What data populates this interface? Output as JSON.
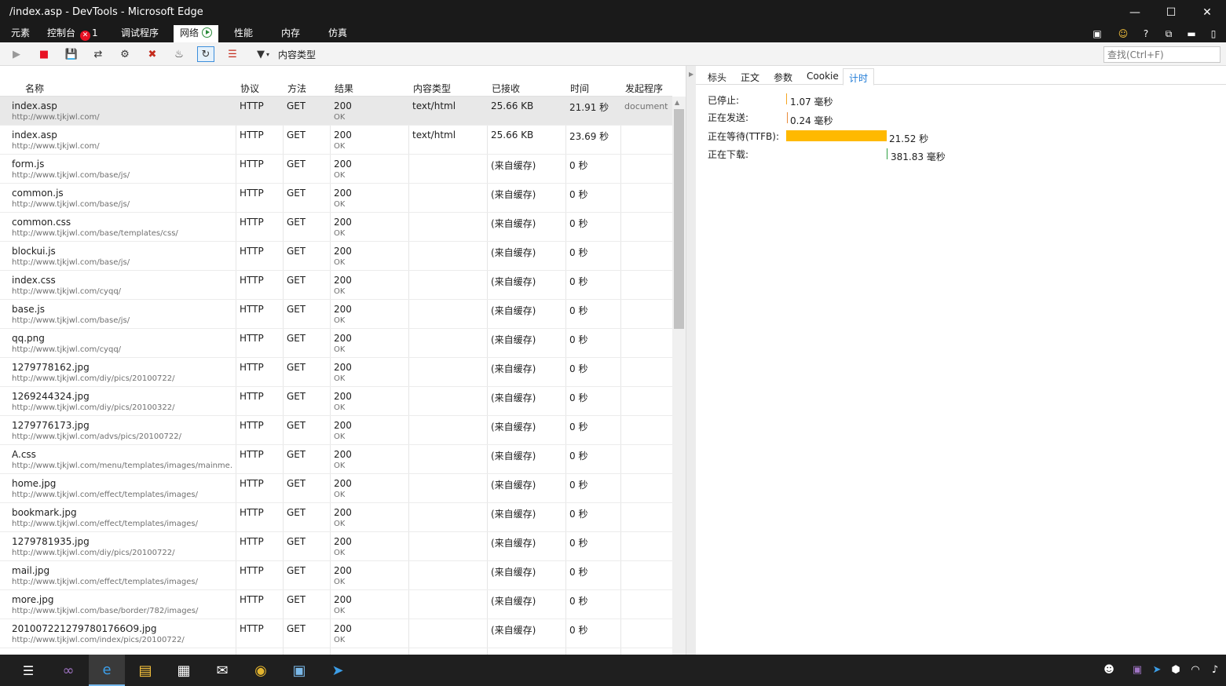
{
  "window": {
    "title": "/index.asp - DevTools - Microsoft Edge",
    "controls": [
      "minimize-icon",
      "maximize-icon",
      "close-icon"
    ]
  },
  "tabs": [
    {
      "label": "元素"
    },
    {
      "label": "控制台",
      "badge": "1"
    },
    {
      "label": "调试程序"
    },
    {
      "label": "网络",
      "active": true
    },
    {
      "label": "性能"
    },
    {
      "label": "内存"
    },
    {
      "label": "仿真"
    }
  ],
  "toolbar": {
    "filter_label": "内容类型",
    "search_placeholder": "查找(Ctrl+F)"
  },
  "columns": {
    "name": "名称",
    "protocol": "协议",
    "method": "方法",
    "result": "结果",
    "content_type": "内容类型",
    "received": "已接收",
    "time": "时间",
    "initiator": "发起程序"
  },
  "requests": [
    {
      "name": "index.asp",
      "url": "http://www.tjkjwl.com/",
      "protocol": "HTTP",
      "method": "GET",
      "status": "200",
      "status_text": "OK",
      "type": "text/html",
      "received": "25.66 KB",
      "time": "21.91 秒",
      "initiator": "document"
    },
    {
      "name": "index.asp",
      "url": "http://www.tjkjwl.com/",
      "protocol": "HTTP",
      "method": "GET",
      "status": "200",
      "status_text": "OK",
      "type": "text/html",
      "received": "25.66 KB",
      "time": "23.69 秒",
      "initiator": ""
    },
    {
      "name": "form.js",
      "url": "http://www.tjkjwl.com/base/js/",
      "protocol": "HTTP",
      "method": "GET",
      "status": "200",
      "status_text": "OK",
      "type": "",
      "received": "(来自缓存)",
      "time": "0 秒",
      "initiator": ""
    },
    {
      "name": "common.js",
      "url": "http://www.tjkjwl.com/base/js/",
      "protocol": "HTTP",
      "method": "GET",
      "status": "200",
      "status_text": "OK",
      "type": "",
      "received": "(来自缓存)",
      "time": "0 秒",
      "initiator": ""
    },
    {
      "name": "common.css",
      "url": "http://www.tjkjwl.com/base/templates/css/",
      "protocol": "HTTP",
      "method": "GET",
      "status": "200",
      "status_text": "OK",
      "type": "",
      "received": "(来自缓存)",
      "time": "0 秒",
      "initiator": ""
    },
    {
      "name": "blockui.js",
      "url": "http://www.tjkjwl.com/base/js/",
      "protocol": "HTTP",
      "method": "GET",
      "status": "200",
      "status_text": "OK",
      "type": "",
      "received": "(来自缓存)",
      "time": "0 秒",
      "initiator": ""
    },
    {
      "name": "index.css",
      "url": "http://www.tjkjwl.com/cyqq/",
      "protocol": "HTTP",
      "method": "GET",
      "status": "200",
      "status_text": "OK",
      "type": "",
      "received": "(来自缓存)",
      "time": "0 秒",
      "initiator": ""
    },
    {
      "name": "base.js",
      "url": "http://www.tjkjwl.com/base/js/",
      "protocol": "HTTP",
      "method": "GET",
      "status": "200",
      "status_text": "OK",
      "type": "",
      "received": "(来自缓存)",
      "time": "0 秒",
      "initiator": ""
    },
    {
      "name": "qq.png",
      "url": "http://www.tjkjwl.com/cyqq/",
      "protocol": "HTTP",
      "method": "GET",
      "status": "200",
      "status_text": "OK",
      "type": "",
      "received": "(来自缓存)",
      "time": "0 秒",
      "initiator": ""
    },
    {
      "name": "1279778162.jpg",
      "url": "http://www.tjkjwl.com/diy/pics/20100722/",
      "protocol": "HTTP",
      "method": "GET",
      "status": "200",
      "status_text": "OK",
      "type": "",
      "received": "(来自缓存)",
      "time": "0 秒",
      "initiator": ""
    },
    {
      "name": "1269244324.jpg",
      "url": "http://www.tjkjwl.com/diy/pics/20100322/",
      "protocol": "HTTP",
      "method": "GET",
      "status": "200",
      "status_text": "OK",
      "type": "",
      "received": "(来自缓存)",
      "time": "0 秒",
      "initiator": ""
    },
    {
      "name": "1279776173.jpg",
      "url": "http://www.tjkjwl.com/advs/pics/20100722/",
      "protocol": "HTTP",
      "method": "GET",
      "status": "200",
      "status_text": "OK",
      "type": "",
      "received": "(来自缓存)",
      "time": "0 秒",
      "initiator": ""
    },
    {
      "name": "A.css",
      "url": "http://www.tjkjwl.com/menu/templates/images/mainme...",
      "protocol": "HTTP",
      "method": "GET",
      "status": "200",
      "status_text": "OK",
      "type": "",
      "received": "(来自缓存)",
      "time": "0 秒",
      "initiator": ""
    },
    {
      "name": "home.jpg",
      "url": "http://www.tjkjwl.com/effect/templates/images/",
      "protocol": "HTTP",
      "method": "GET",
      "status": "200",
      "status_text": "OK",
      "type": "",
      "received": "(来自缓存)",
      "time": "0 秒",
      "initiator": ""
    },
    {
      "name": "bookmark.jpg",
      "url": "http://www.tjkjwl.com/effect/templates/images/",
      "protocol": "HTTP",
      "method": "GET",
      "status": "200",
      "status_text": "OK",
      "type": "",
      "received": "(来自缓存)",
      "time": "0 秒",
      "initiator": ""
    },
    {
      "name": "1279781935.jpg",
      "url": "http://www.tjkjwl.com/diy/pics/20100722/",
      "protocol": "HTTP",
      "method": "GET",
      "status": "200",
      "status_text": "OK",
      "type": "",
      "received": "(来自缓存)",
      "time": "0 秒",
      "initiator": ""
    },
    {
      "name": "mail.jpg",
      "url": "http://www.tjkjwl.com/effect/templates/images/",
      "protocol": "HTTP",
      "method": "GET",
      "status": "200",
      "status_text": "OK",
      "type": "",
      "received": "(来自缓存)",
      "time": "0 秒",
      "initiator": ""
    },
    {
      "name": "more.jpg",
      "url": "http://www.tjkjwl.com/base/border/782/images/",
      "protocol": "HTTP",
      "method": "GET",
      "status": "200",
      "status_text": "OK",
      "type": "",
      "received": "(来自缓存)",
      "time": "0 秒",
      "initiator": ""
    },
    {
      "name": "2010072212797801766O9.jpg",
      "url": "http://www.tjkjwl.com/index/pics/20100722/",
      "protocol": "HTTP",
      "method": "GET",
      "status": "200",
      "status_text": "OK",
      "type": "",
      "received": "(来自缓存)",
      "time": "0 秒",
      "initiator": ""
    }
  ],
  "details": {
    "tabs": [
      "标头",
      "正文",
      "参数",
      "Cookie",
      "计时"
    ],
    "active_tab": "计时",
    "timing": [
      {
        "label": "已停止:",
        "value": "1.07 毫秒"
      },
      {
        "label": "正在发送:",
        "value": "0.24 毫秒"
      },
      {
        "label": "正在等待(TTFB):",
        "value": "21.52 秒"
      },
      {
        "label": "正在下载:",
        "value": "381.83 毫秒"
      }
    ],
    "colors": {
      "stalled": "#f5a623",
      "sending": "#e88a3a",
      "waiting": "#ffb900",
      "downloading": "#2ea043"
    }
  },
  "taskbar": {
    "apps": [
      "task-view-icon",
      "visual-studio-icon",
      "edge-icon",
      "file-explorer-icon",
      "store-icon",
      "mail-icon",
      "chrome-icon",
      "app-icon",
      "feishu-icon"
    ]
  }
}
